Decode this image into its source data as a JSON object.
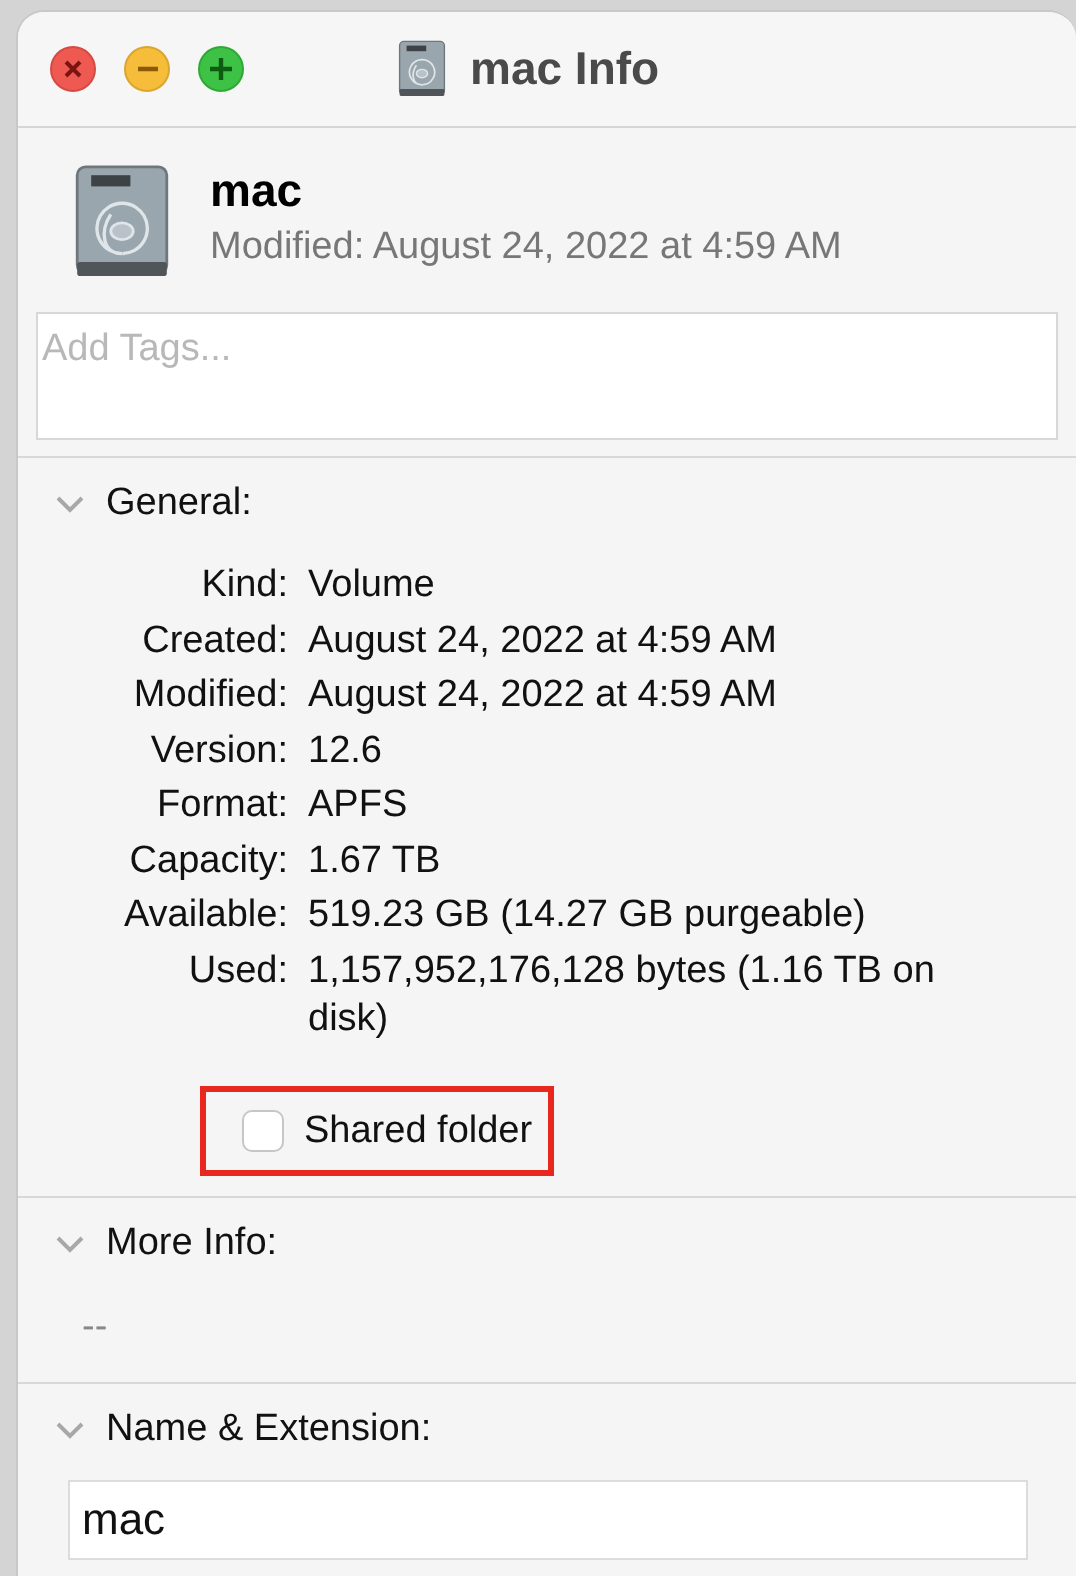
{
  "window": {
    "title": "mac Info"
  },
  "header": {
    "name": "mac",
    "modified_label": "Modified:",
    "modified_value": "August 24, 2022 at 4:59 AM"
  },
  "tags": {
    "placeholder": "Add Tags..."
  },
  "sections": [
    {
      "kind": "general",
      "title": "General:",
      "expanded": true,
      "rows": [
        {
          "label": "Kind:",
          "value": "Volume"
        },
        {
          "label": "Created:",
          "value": "August 24, 2022 at 4:59 AM"
        },
        {
          "label": "Modified:",
          "value": "August 24, 2022 at 4:59 AM"
        },
        {
          "label": "Version:",
          "value": "12.6"
        },
        {
          "label": "Format:",
          "value": "APFS"
        },
        {
          "label": "Capacity:",
          "value": "1.67 TB"
        },
        {
          "label": "Available:",
          "value": "519.23 GB (14.27 GB purgeable)"
        },
        {
          "label": "Used:",
          "value": "1,157,952,176,128 bytes (1.16 TB on disk)"
        }
      ],
      "checkbox": {
        "label": "Shared folder",
        "checked": false,
        "highlighted": true
      }
    },
    {
      "kind": "text",
      "title": "More Info:",
      "expanded": true,
      "text": "--"
    },
    {
      "kind": "field",
      "title": "Name & Extension:",
      "expanded": true,
      "value": "mac"
    }
  ]
}
